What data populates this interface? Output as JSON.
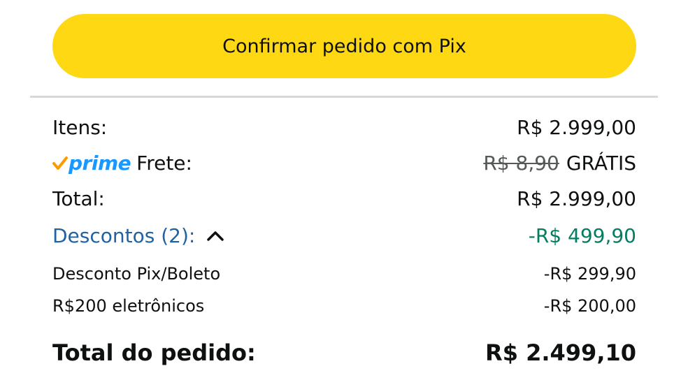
{
  "button": {
    "label": "Confirmar pedido com Pix"
  },
  "summary": {
    "items": {
      "label": "Itens:",
      "value": "R$ 2.999,00"
    },
    "shipping": {
      "prime_word": "prime",
      "label": "Frete:",
      "old_value": "R$ 8,90",
      "value": "GRÁTIS"
    },
    "total": {
      "label": "Total:",
      "value": "R$ 2.999,00"
    },
    "discounts": {
      "label": "Descontos (2):",
      "value": "-R$ 499,90",
      "expanded": true,
      "items": [
        {
          "label": "Desconto Pix/Boleto",
          "value": "-R$ 299,90"
        },
        {
          "label": "R$200 eletrônicos",
          "value": "-R$ 200,00"
        }
      ]
    },
    "order_total": {
      "label": "Total do pedido:",
      "value": "R$ 2.499,10"
    }
  },
  "colors": {
    "button": "#ffd814",
    "link": "#2162a1",
    "discount": "#067d62",
    "prime": "#1a98ff",
    "prime_check": "#ff9900"
  }
}
